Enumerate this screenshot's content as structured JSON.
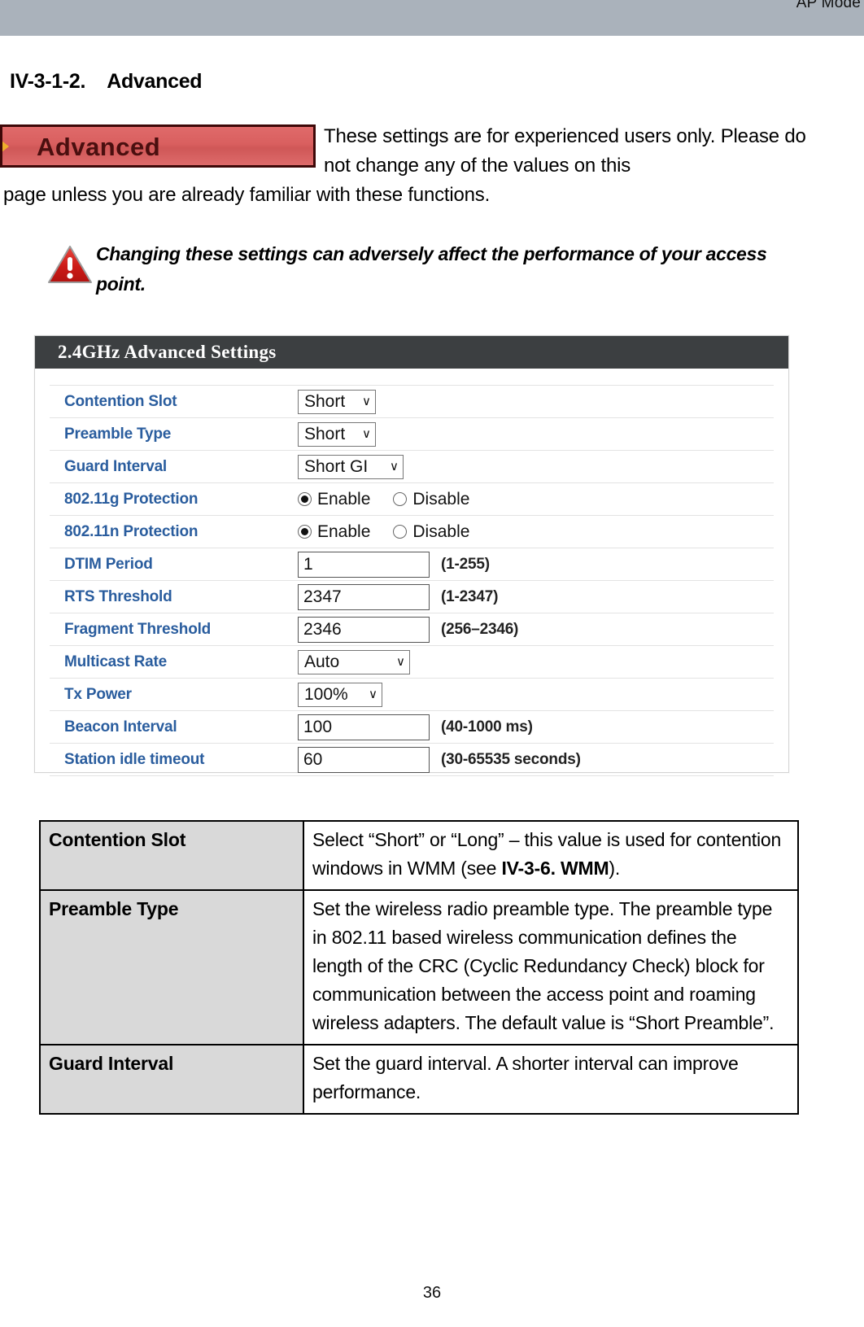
{
  "header": {
    "mode_label": "AP Mode"
  },
  "section": {
    "number": "IV-3-1-2.",
    "title": "Advanced"
  },
  "badge": {
    "label": "Advanced"
  },
  "intro": {
    "line1": "These settings are for experienced users only. Please do not change any of the values on this",
    "line2": "page unless you are already familiar with these functions."
  },
  "warning": {
    "icon": "warning-triangle-icon",
    "text": "Changing these settings can adversely affect the performance of your access point."
  },
  "panel": {
    "title": "2.4GHz Advanced Settings",
    "rows": [
      {
        "label": "Contention Slot",
        "type": "select",
        "value": "Short",
        "caret": "∨",
        "width_class": "w-short"
      },
      {
        "label": "Preamble Type",
        "type": "select",
        "value": "Short",
        "caret": "∨",
        "width_class": "w-short"
      },
      {
        "label": "Guard Interval",
        "type": "select",
        "value": "Short GI",
        "caret": "∨",
        "width_class": "w-shortgi"
      },
      {
        "label": "802.11g Protection",
        "type": "radio",
        "options": [
          {
            "label": "Enable",
            "selected": true
          },
          {
            "label": "Disable",
            "selected": false
          }
        ]
      },
      {
        "label": "802.11n Protection",
        "type": "radio",
        "options": [
          {
            "label": "Enable",
            "selected": true
          },
          {
            "label": "Disable",
            "selected": false
          }
        ]
      },
      {
        "label": "DTIM Period",
        "type": "text",
        "value": "1",
        "hint": "(1-255)"
      },
      {
        "label": "RTS Threshold",
        "type": "text",
        "value": "2347",
        "hint": "(1-2347)"
      },
      {
        "label": "Fragment Threshold",
        "type": "text",
        "value": "2346",
        "hint": "(256–2346)"
      },
      {
        "label": "Multicast Rate",
        "type": "select",
        "value": "Auto",
        "caret": "∨",
        "width_class": "w-auto"
      },
      {
        "label": "Tx Power",
        "type": "select",
        "value": "100%",
        "caret": "∨",
        "width_class": "w-pct"
      },
      {
        "label": "Beacon Interval",
        "type": "text",
        "value": "100",
        "hint": "(40-1000 ms)"
      },
      {
        "label": "Station idle timeout",
        "type": "text",
        "value": "60",
        "hint": "(30-65535 seconds)"
      }
    ]
  },
  "descriptions": [
    {
      "term": "Contention Slot",
      "definition_pre": "Select “Short” or “Long” – this value is used for contention windows in WMM (see ",
      "definition_bold": "IV-3-6. WMM",
      "definition_post": ")."
    },
    {
      "term": "Preamble Type",
      "definition": "Set the wireless radio preamble type. The preamble type in 802.11 based wireless communication defines the length of the CRC (Cyclic Redundancy Check) block for communication between the access point and roaming wireless adapters. The default value is “Short Preamble”."
    },
    {
      "term": "Guard Interval",
      "definition": "Set the guard interval. A shorter interval can improve performance."
    }
  ],
  "footer": {
    "page_number": "36"
  },
  "colors": {
    "header_band": "#aab2bb",
    "badge_fill": "#d95f5f",
    "badge_border": "#3d0808",
    "panel_title_bg": "#3c3f41",
    "row_label": "#2a5d9e",
    "table_term_bg": "#d9d9d9"
  }
}
